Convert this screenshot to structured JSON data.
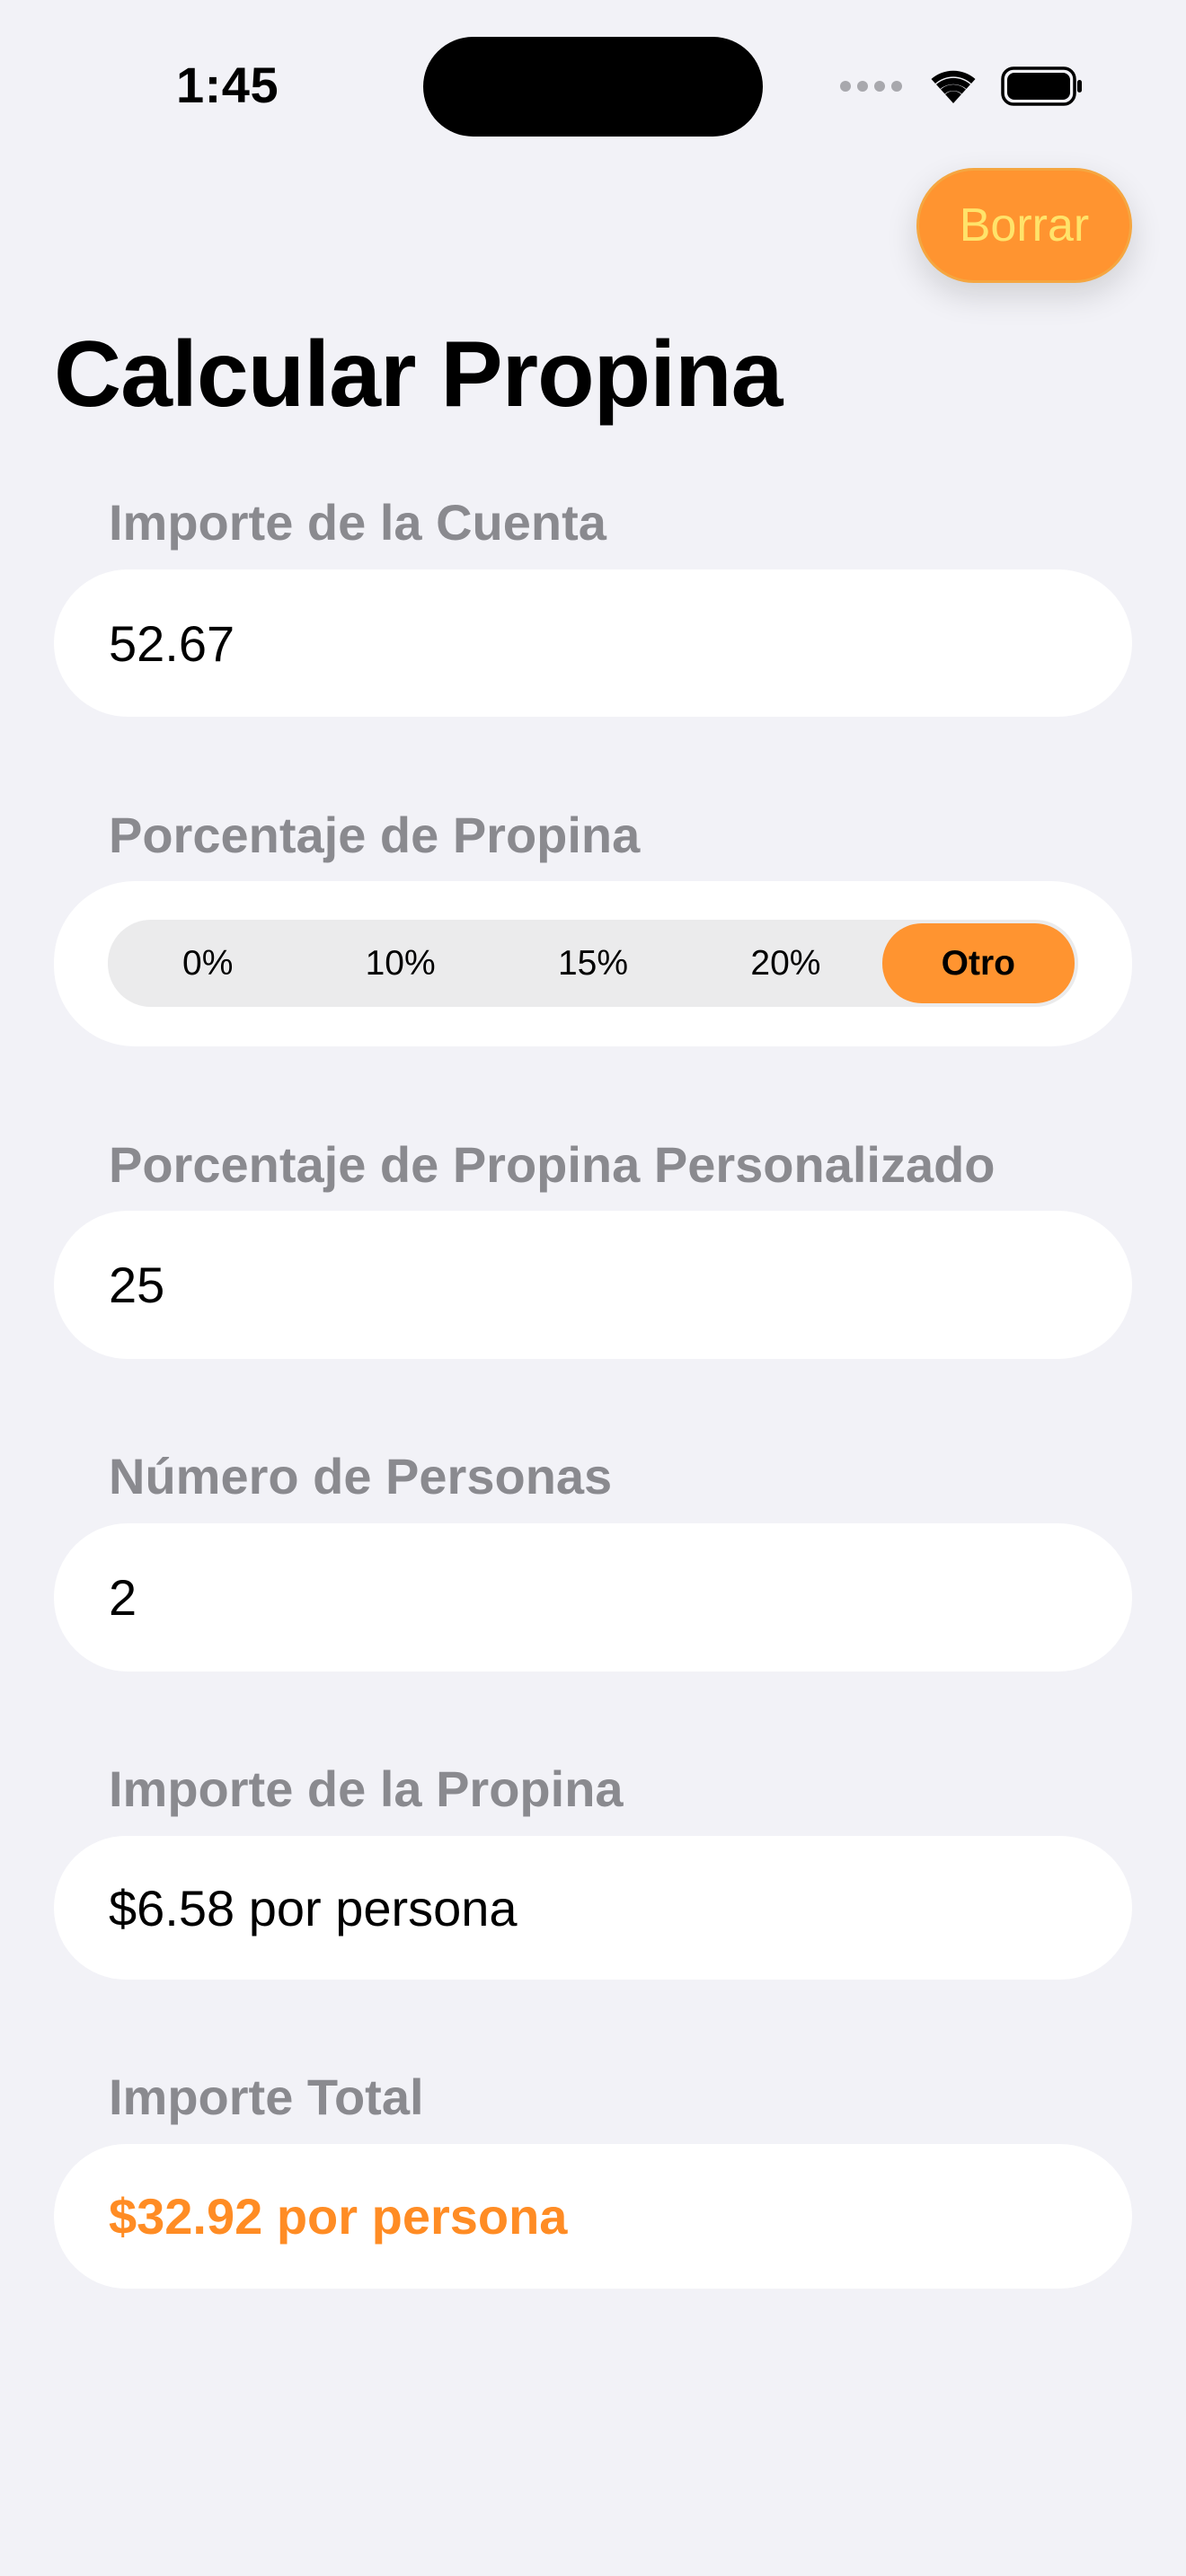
{
  "status_bar": {
    "time": "1:45"
  },
  "header": {
    "clear_label": "Borrar",
    "title": "Calcular Propina"
  },
  "bill": {
    "label": "Importe de la Cuenta",
    "value": "52.67"
  },
  "tip_percentage": {
    "label": "Porcentaje de Propina",
    "options": [
      "0%",
      "10%",
      "15%",
      "20%",
      "Otro"
    ],
    "selected": "Otro"
  },
  "custom_tip": {
    "label": "Porcentaje de Propina Personalizado",
    "value": "25"
  },
  "people": {
    "label": "Número de Personas",
    "value": "2"
  },
  "tip_amount": {
    "label": "Importe de la Propina",
    "value": "$6.58 por persona"
  },
  "total_amount": {
    "label": "Importe Total",
    "value": "$32.92 por persona"
  },
  "colors": {
    "accent": "#FF9430",
    "clear_text": "#FFE36A",
    "total_text": "#FF8C24",
    "background": "#F2F2F7",
    "label_gray": "#8A8A8F"
  }
}
